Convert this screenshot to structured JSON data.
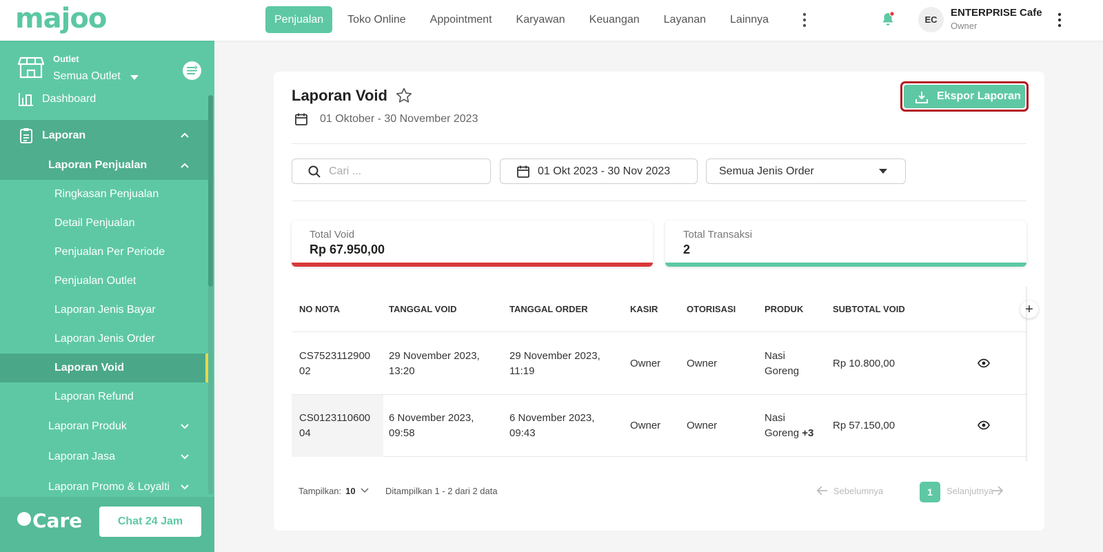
{
  "brand": {
    "logo_text": "majoo",
    "accent": "#5ec8a4",
    "danger": "#d9383a"
  },
  "topnav": {
    "items": [
      "Penjualan",
      "Toko Online",
      "Appointment",
      "Karyawan",
      "Keuangan",
      "Layanan",
      "Lainnya"
    ],
    "active": "Penjualan"
  },
  "user": {
    "initials": "EC",
    "name": "ENTERPRISE Cafe",
    "role": "Owner"
  },
  "sidebar": {
    "outlet_label": "Outlet",
    "outlet_value": "Semua Outlet",
    "items": [
      {
        "label": "Dashboard"
      },
      {
        "label": "Laporan"
      },
      {
        "label": "Laporan Penjualan"
      },
      {
        "label": "Ringkasan Penjualan"
      },
      {
        "label": "Detail Penjualan"
      },
      {
        "label": "Penjualan Per Periode"
      },
      {
        "label": "Penjualan Outlet"
      },
      {
        "label": "Laporan Jenis Bayar"
      },
      {
        "label": "Laporan Jenis Order"
      },
      {
        "label": "Laporan Void"
      },
      {
        "label": "Laporan Refund"
      },
      {
        "label": "Laporan Produk"
      },
      {
        "label": "Laporan Jasa"
      },
      {
        "label": "Laporan Promo & Loyalti"
      }
    ],
    "care_logo": "Care",
    "chat_button": "Chat 24 Jam"
  },
  "page": {
    "title": "Laporan Void",
    "date_range": "01 Oktober - 30 November 2023",
    "export_button": "Ekspor Laporan"
  },
  "filters": {
    "search_placeholder": "Cari ...",
    "date_value": "01 Okt 2023 - 30 Nov 2023",
    "order_type": "Semua Jenis Order"
  },
  "stats": {
    "void_label": "Total Void",
    "void_value": "Rp 67.950,00",
    "trx_label": "Total Transaksi",
    "trx_value": "2"
  },
  "table": {
    "headers": [
      "NO NOTA",
      "TANGGAL VOID",
      "TANGGAL ORDER",
      "KASIR",
      "OTORISASI",
      "PRODUK",
      "SUBTOTAL VOID"
    ],
    "rows": [
      {
        "no_nota_1": "CS7523112900",
        "no_nota_2": "02",
        "tgl_void_1": "29 November 2023,",
        "tgl_void_2": "13:20",
        "tgl_order_1": "29 November 2023,",
        "tgl_order_2": "11:19",
        "kasir": "Owner",
        "otorisasi": "Owner",
        "produk_1": "Nasi",
        "produk_2": "Goreng",
        "produk_extra": "",
        "subtotal": "Rp 10.800,00"
      },
      {
        "no_nota_1": "CS0123110600",
        "no_nota_2": "04",
        "tgl_void_1": "6 November 2023,",
        "tgl_void_2": "09:58",
        "tgl_order_1": "6 November 2023,",
        "tgl_order_2": "09:43",
        "kasir": "Owner",
        "otorisasi": "Owner",
        "produk_1": "Nasi",
        "produk_2": "Goreng",
        "produk_extra": "+3",
        "subtotal": "Rp 57.150,00"
      }
    ]
  },
  "pagination": {
    "show_label": "Tampilkan:",
    "page_size": "10",
    "info": "Ditampilkan 1 - 2 dari 2 data",
    "prev": "Sebelumnya",
    "current": "1",
    "next": "Selanjutnya"
  }
}
